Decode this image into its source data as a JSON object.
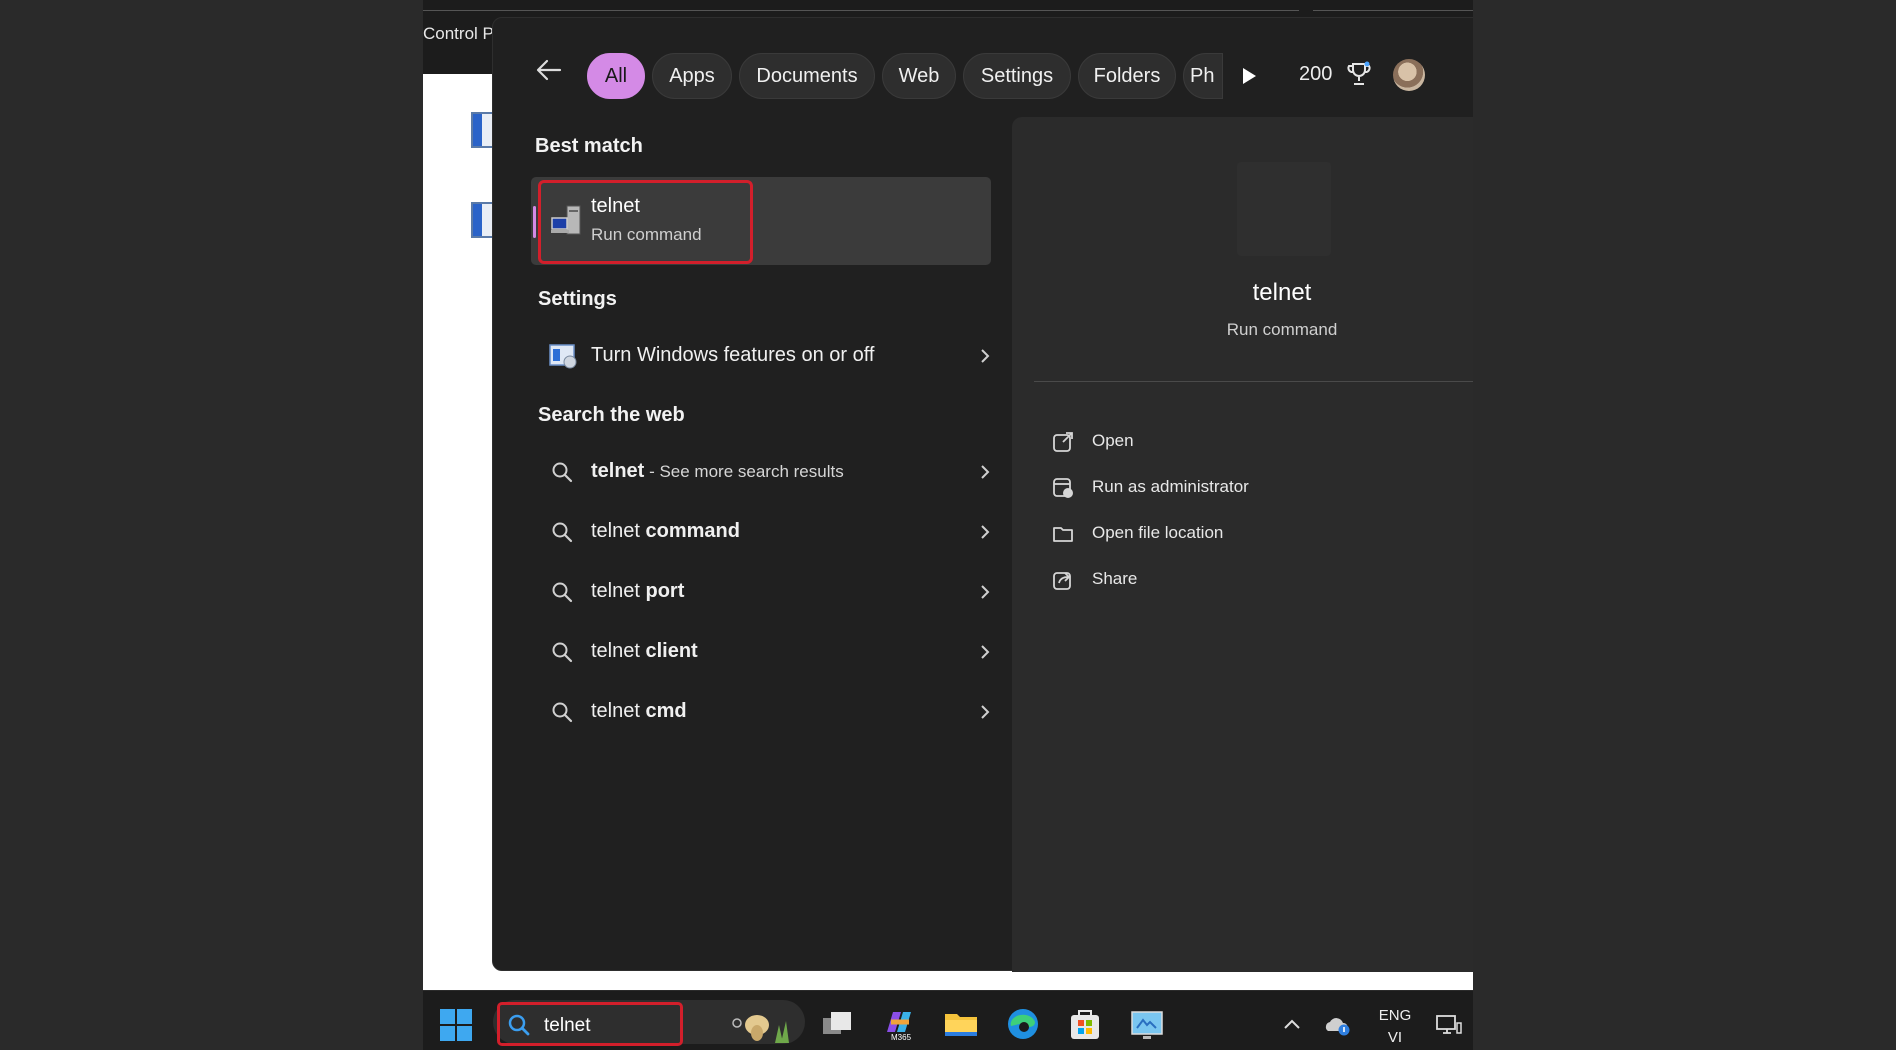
{
  "background_window": {
    "title": "Control P"
  },
  "flyout": {
    "filters": [
      "All",
      "Apps",
      "Documents",
      "Web",
      "Settings",
      "Folders",
      "Ph"
    ],
    "active_filter": "All",
    "points": "200"
  },
  "results": {
    "best_match_header": "Best match",
    "best_match": {
      "title": "telnet",
      "subtitle": "Run command"
    },
    "settings_header": "Settings",
    "settings_item": "Turn Windows features on or off",
    "web_header": "Search the web",
    "web_items": [
      {
        "bold": "telnet",
        "rest": " - See more search results"
      },
      {
        "plain": "telnet ",
        "bold": "command"
      },
      {
        "plain": "telnet ",
        "bold": "port"
      },
      {
        "plain": "telnet ",
        "bold": "client"
      },
      {
        "plain": "telnet ",
        "bold": "cmd"
      }
    ]
  },
  "preview": {
    "title": "telnet",
    "subtitle": "Run command",
    "actions": [
      {
        "label": "Open",
        "icon": "open-external-icon"
      },
      {
        "label": "Run as administrator",
        "icon": "shield-admin-icon"
      },
      {
        "label": "Open file location",
        "icon": "folder-icon"
      },
      {
        "label": "Share",
        "icon": "share-icon"
      }
    ]
  },
  "taskbar": {
    "search_text": "telnet",
    "apps": [
      "task-view",
      "m365-copilot",
      "file-explorer",
      "edge",
      "microsoft-store",
      "remote-desktop"
    ],
    "m365_label": "M365",
    "language": [
      "ENG",
      "VI"
    ]
  },
  "colors": {
    "accent": "#d48ae6",
    "highlight_box": "#d21f2b",
    "flyout_bg": "#202020",
    "preview_bg": "#2b2b2b"
  }
}
